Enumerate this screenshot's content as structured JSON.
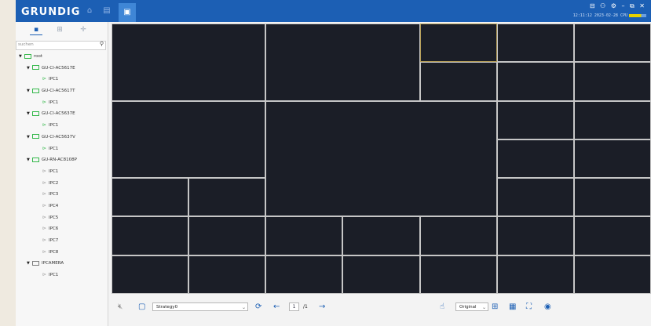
{
  "app": {
    "logo": "GRUNDIG"
  },
  "titlebar": {
    "window_controls": "⊟ ⚇ ⚙ – ⧉ ✕",
    "time_cpu": "12:11:12 2023-02-28 CPU"
  },
  "sidebar": {
    "search_placeholder": "suchen",
    "tree": [
      {
        "label": "root",
        "level": 0,
        "kind": "group"
      },
      {
        "label": "GU-CI-AC5617E",
        "level": 1,
        "kind": "device"
      },
      {
        "label": "IPC1",
        "level": 2,
        "kind": "camera"
      },
      {
        "label": "GU-CI-AC5617T",
        "level": 1,
        "kind": "device"
      },
      {
        "label": "IPC1",
        "level": 2,
        "kind": "camera"
      },
      {
        "label": "GU-CI-AC5637E",
        "level": 1,
        "kind": "device"
      },
      {
        "label": "IPC1",
        "level": 2,
        "kind": "camera"
      },
      {
        "label": "GU-CI-AC5637V",
        "level": 1,
        "kind": "device"
      },
      {
        "label": "IPC1",
        "level": 2,
        "kind": "camera"
      },
      {
        "label": "GU-RN-AC8108P",
        "level": 1,
        "kind": "device"
      },
      {
        "label": "IPC1",
        "level": 2,
        "kind": "camera-off"
      },
      {
        "label": "IPC2",
        "level": 2,
        "kind": "camera-off"
      },
      {
        "label": "IPC3",
        "level": 2,
        "kind": "camera-off"
      },
      {
        "label": "IPC4",
        "level": 2,
        "kind": "camera-off"
      },
      {
        "label": "IPC5",
        "level": 2,
        "kind": "camera-off"
      },
      {
        "label": "IPC6",
        "level": 2,
        "kind": "camera-off"
      },
      {
        "label": "IPC7",
        "level": 2,
        "kind": "camera-off"
      },
      {
        "label": "IPC8",
        "level": 2,
        "kind": "camera-off"
      },
      {
        "label": "IPCAMERA",
        "level": 1,
        "kind": "device-off"
      },
      {
        "label": "IPC1",
        "level": 2,
        "kind": "camera-off"
      }
    ]
  },
  "bottom_bar": {
    "strategy": "Strategy0",
    "page_current": "1",
    "page_total": "/1",
    "scale": "Original"
  }
}
